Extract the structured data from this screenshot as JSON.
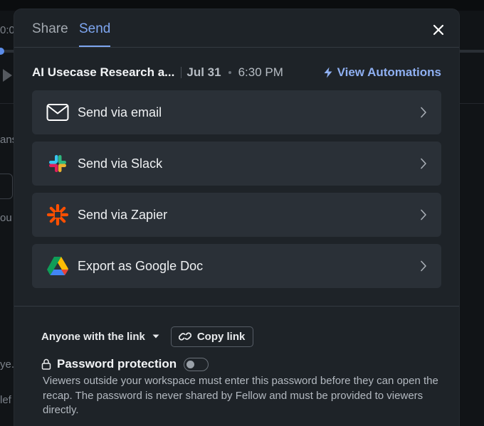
{
  "background": {
    "fragments": [
      "0:0",
      "ans",
      "ou",
      "ye.",
      "lef"
    ]
  },
  "tabs": {
    "share_label": "Share",
    "send_label": "Send",
    "active": "Send"
  },
  "meeting": {
    "title": "AI Usecase Research a...",
    "date": "Jul 31",
    "time": "6:30 PM",
    "automations_label": "View Automations"
  },
  "options": [
    {
      "label": "Send via email",
      "icon": "envelope-icon"
    },
    {
      "label": "Send via Slack",
      "icon": "slack-icon"
    },
    {
      "label": "Send via Zapier",
      "icon": "zapier-icon"
    },
    {
      "label": "Export as Google Doc",
      "icon": "google-drive-icon"
    }
  ],
  "sharing": {
    "access_label": "Anyone with the link",
    "copy_label": "Copy link",
    "password_label": "Password protection",
    "password_enabled": false,
    "password_description": "Viewers outside your workspace must enter this password before they can open the recap. The password is never shared by Fellow and must be provided to viewers directly."
  },
  "colors": {
    "accent": "#7ea6f0",
    "modal_bg": "#1e2328",
    "option_bg": "#2a3037",
    "zapier_orange": "#ff4f00"
  }
}
